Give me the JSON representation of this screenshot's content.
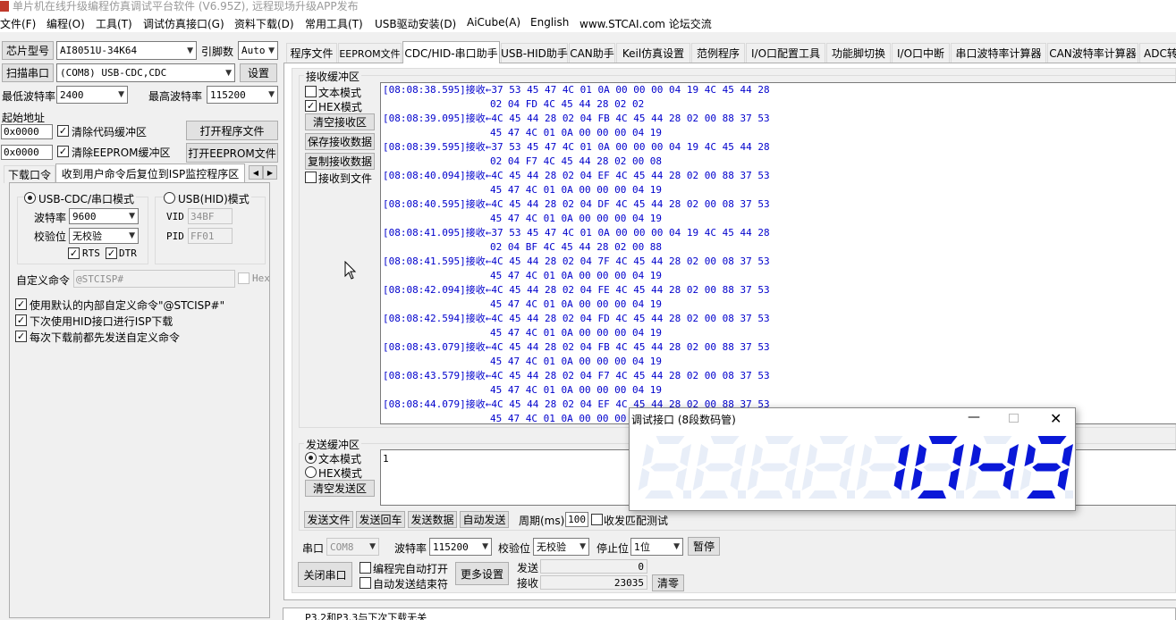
{
  "title": "单片机在线升级编程仿真调试平台软件 (V6.95Z), 远程现场升级APP发布",
  "menu": [
    "文件(F)",
    "编程(O)",
    "工具(T)",
    "调试仿真接口(G)",
    "资料下载(D)",
    "常用工具(T)",
    "USB驱动安装(D)",
    "AiCube(A)",
    "English",
    "www.STCAI.com 论坛交流"
  ],
  "left": {
    "chip_label": "芯片型号",
    "chip_value": "AI8051U-34K64",
    "pins_label": "引脚数",
    "pins_value": "Auto",
    "scan_label": "扫描串口",
    "port_value": "(COM8) USB-CDC,CDC",
    "settings_label": "设置",
    "min_baud_label": "最低波特率",
    "min_baud_value": "2400",
    "max_baud_label": "最高波特率",
    "max_baud_value": "115200",
    "start_addr_label": "起始地址",
    "addr1": "0x0000",
    "addr2": "0x0000",
    "clear_code_label": "清除代码缓冲区",
    "clear_eeprom_label": "清除EEPROM缓冲区",
    "open_prog_label": "打开程序文件",
    "open_eeprom_label": "打开EEPROM文件",
    "subtab1": "下载口令",
    "subtab2": "收到用户命令后复位到ISP监控程序区",
    "usb_cdc_label": "USB-CDC/串口模式",
    "usb_hid_label": "USB(HID)模式",
    "baud_label": "波特率",
    "baud_value": "9600",
    "parity_label": "校验位",
    "parity_value": "无校验",
    "vid_label": "VID",
    "vid_value": "34BF",
    "pid_label": "PID",
    "pid_value": "FF01",
    "rts_label": "RTS",
    "dtr_label": "DTR",
    "custom_cmd_label": "自定义命令",
    "custom_cmd_value": "@STCISP#",
    "hex_label": "Hex",
    "opt1": "使用默认的内部自定义命令\"@STCISP#\"",
    "opt2": "下次使用HID接口进行ISP下载",
    "opt3": "每次下载前都先发送自定义命令"
  },
  "tabs": [
    "程序文件",
    "EEPROM文件",
    "CDC/HID-串口助手",
    "USB-HID助手",
    "CAN助手",
    "Keil仿真设置",
    "范例程序",
    "I/O口配置工具",
    "功能脚切换",
    "I/O口中断",
    "串口波特率计算器",
    "CAN波特率计算器",
    "ADC转换"
  ],
  "rx": {
    "title": "接收缓冲区",
    "text_mode": "文本模式",
    "hex_mode": "HEX模式",
    "clear": "清空接收区",
    "save": "保存接收数据",
    "copy": "复制接收数据",
    "to_file": "接收到文件",
    "lines": [
      {
        "ts": "[08:08:38.595]接收←",
        "d": "37 53 45 47 4C 01 0A 00 00 00 04 19 4C 45 44 28"
      },
      {
        "ts": "",
        "d": "02 04 FD 4C 45 44 28 02 02"
      },
      {
        "ts": "[08:08:39.095]接收←",
        "d": "4C 45 44 28 02 04 FB 4C 45 44 28 02 00 88 37 53"
      },
      {
        "ts": "",
        "d": "45 47 4C 01 0A 00 00 00 04 19"
      },
      {
        "ts": "[08:08:39.595]接收←",
        "d": "37 53 45 47 4C 01 0A 00 00 00 04 19 4C 45 44 28"
      },
      {
        "ts": "",
        "d": "02 04 F7 4C 45 44 28 02 00 08"
      },
      {
        "ts": "[08:08:40.094]接收←",
        "d": "4C 45 44 28 02 04 EF 4C 45 44 28 02 00 88 37 53"
      },
      {
        "ts": "",
        "d": "45 47 4C 01 0A 00 00 00 04 19"
      },
      {
        "ts": "[08:08:40.595]接收←",
        "d": "4C 45 44 28 02 04 DF 4C 45 44 28 02 00 08 37 53"
      },
      {
        "ts": "",
        "d": "45 47 4C 01 0A 00 00 00 04 19"
      },
      {
        "ts": "[08:08:41.095]接收←",
        "d": "37 53 45 47 4C 01 0A 00 00 00 04 19 4C 45 44 28"
      },
      {
        "ts": "",
        "d": "02 04 BF 4C 45 44 28 02 00 88"
      },
      {
        "ts": "[08:08:41.595]接收←",
        "d": "4C 45 44 28 02 04 7F 4C 45 44 28 02 00 08 37 53"
      },
      {
        "ts": "",
        "d": "45 47 4C 01 0A 00 00 00 04 19"
      },
      {
        "ts": "[08:08:42.094]接收←",
        "d": "4C 45 44 28 02 04 FE 4C 45 44 28 02 00 88 37 53"
      },
      {
        "ts": "",
        "d": "45 47 4C 01 0A 00 00 00 04 19"
      },
      {
        "ts": "[08:08:42.594]接收←",
        "d": "4C 45 44 28 02 04 FD 4C 45 44 28 02 00 08 37 53"
      },
      {
        "ts": "",
        "d": "45 47 4C 01 0A 00 00 00 04 19"
      },
      {
        "ts": "[08:08:43.079]接收←",
        "d": "4C 45 44 28 02 04 FB 4C 45 44 28 02 00 88 37 53"
      },
      {
        "ts": "",
        "d": "45 47 4C 01 0A 00 00 00 04 19"
      },
      {
        "ts": "[08:08:43.579]接收←",
        "d": "4C 45 44 28 02 04 F7 4C 45 44 28 02 00 08 37 53"
      },
      {
        "ts": "",
        "d": "45 47 4C 01 0A 00 00 00 04 19"
      },
      {
        "ts": "[08:08:44.079]接收←",
        "d": "4C 45 44 28 02 04 EF 4C 45 44 28 02 00 88 37 53"
      },
      {
        "ts": "",
        "d": "45 47 4C 01 0A 00 00 00 04 19"
      }
    ]
  },
  "tx": {
    "title": "发送缓冲区",
    "text_mode": "文本模式",
    "hex_mode": "HEX模式",
    "clear": "清空发送区",
    "content": "1",
    "send_file": "发送文件",
    "send_cr": "发送回车",
    "send_data": "发送数据",
    "auto_send": "自动发送",
    "period_label": "周期(ms)",
    "period_value": "100",
    "match_label": "收发匹配测试"
  },
  "serial": {
    "port_label": "串口",
    "port_value": "COM8",
    "baud_label": "波特率",
    "baud_value": "115200",
    "parity_label": "校验位",
    "parity_value": "无校验",
    "stop_label": "停止位",
    "stop_value": "1位",
    "pause": "暂停",
    "close": "关闭串口",
    "auto_open": "编程完自动打开",
    "auto_end": "自动发送结束符",
    "more": "更多设置",
    "send_label": "发送",
    "send_count": "0",
    "recv_label": "接收",
    "recv_count": "23035",
    "clear": "清零"
  },
  "status": "P3.2和P3.3与下次下载无关",
  "popup": {
    "title": "调试接口 (8段数码管)",
    "digits": [
      "",
      "",
      "",
      "",
      "1",
      "0",
      "4",
      "9"
    ],
    "color_on": "#0a18d8",
    "color_off": "#e8eef8"
  }
}
